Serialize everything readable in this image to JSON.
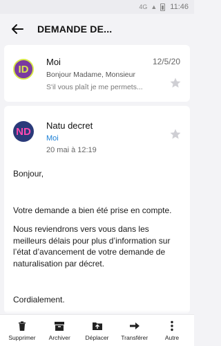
{
  "status_bar": {
    "network": "4G",
    "time": "11:46"
  },
  "header": {
    "title": "DEMANDE DE..."
  },
  "summary": {
    "avatar_letters": "ID",
    "sender": "Moi",
    "date": "12/5/20",
    "preview_1": "Bonjour Madame, Monsieur",
    "preview_2": "S'il vous plaît je me permets..."
  },
  "message": {
    "avatar_letters": "ND",
    "sender": "Natu decret",
    "recipient": "Moi",
    "date": "20 mai à 12:19",
    "greeting": "Bonjour,",
    "paragraph_1": "Votre demande a bien été prise en compte.",
    "paragraph_2": "Nous reviendrons vers vous dans les meilleurs délais pour plus d’information sur l’état d’avancement de votre demande de naturalisation par décret.",
    "closing": "Cordialement."
  },
  "toolbar": {
    "delete": "Supprimer",
    "archive": "Archiver",
    "move": "Déplacer",
    "forward": "Transférer",
    "more": "Autre"
  },
  "colors": {
    "accent_link": "#1a7fd6",
    "background": "#f3f3f6"
  }
}
